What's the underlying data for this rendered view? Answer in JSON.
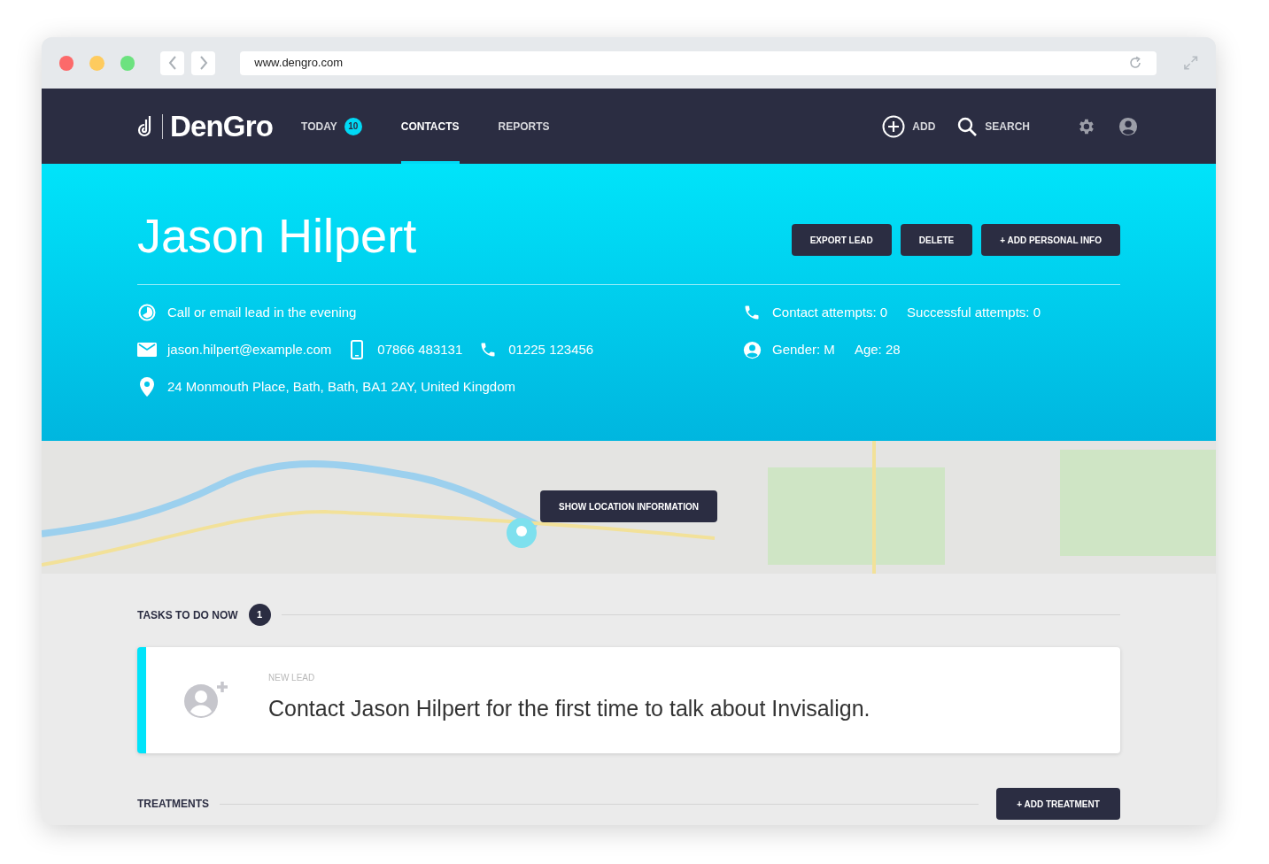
{
  "browser": {
    "url": "www.dengro.com"
  },
  "nav": {
    "logo": "DenGro",
    "tabs": [
      {
        "label": "TODAY",
        "badge": "10",
        "selected": false
      },
      {
        "label": "CONTACTS",
        "selected": true
      },
      {
        "label": "REPORTS",
        "selected": false
      }
    ],
    "actions": [
      {
        "kind": "add",
        "label": "ADD"
      },
      {
        "kind": "search",
        "label": "SEARCH"
      }
    ]
  },
  "contact": {
    "name": "Jason Hilpert",
    "buttons": [
      "EXPORT LEAD",
      "DELETE",
      "+ ADD PERSONAL INFO"
    ],
    "left_rows": [
      [
        {
          "kind": "clock",
          "text": "Call or email lead in the evening"
        }
      ],
      [
        {
          "kind": "mail",
          "text": "jason.hilpert@example.com"
        },
        {
          "kind": "mobile",
          "text": "07866 483131"
        },
        {
          "kind": "phone",
          "text": "01225 123456"
        }
      ],
      [
        {
          "kind": "pin",
          "text": "24 Monmouth Place, Bath, Bath, BA1 2AY, United Kingdom"
        }
      ]
    ],
    "right_rows": [
      [
        {
          "kind": "phone",
          "text": "Contact attempts: 0"
        },
        {
          "kind": "none",
          "text": "Successful attempts: 0"
        }
      ],
      [
        {
          "kind": "person",
          "text": "Gender: M"
        },
        {
          "kind": "none",
          "text": "Age: 28"
        }
      ]
    ]
  },
  "map": {
    "button": "SHOW LOCATION INFORMATION"
  },
  "tasks": {
    "title": "TASKS TO DO NOW",
    "count": "1",
    "items": [
      {
        "category": "NEW LEAD",
        "text": "Contact Jason Hilpert for the first time to talk about Invisalign."
      }
    ]
  },
  "treatments": {
    "title": "TREATMENTS",
    "button": "+ ADD TREATMENT"
  }
}
